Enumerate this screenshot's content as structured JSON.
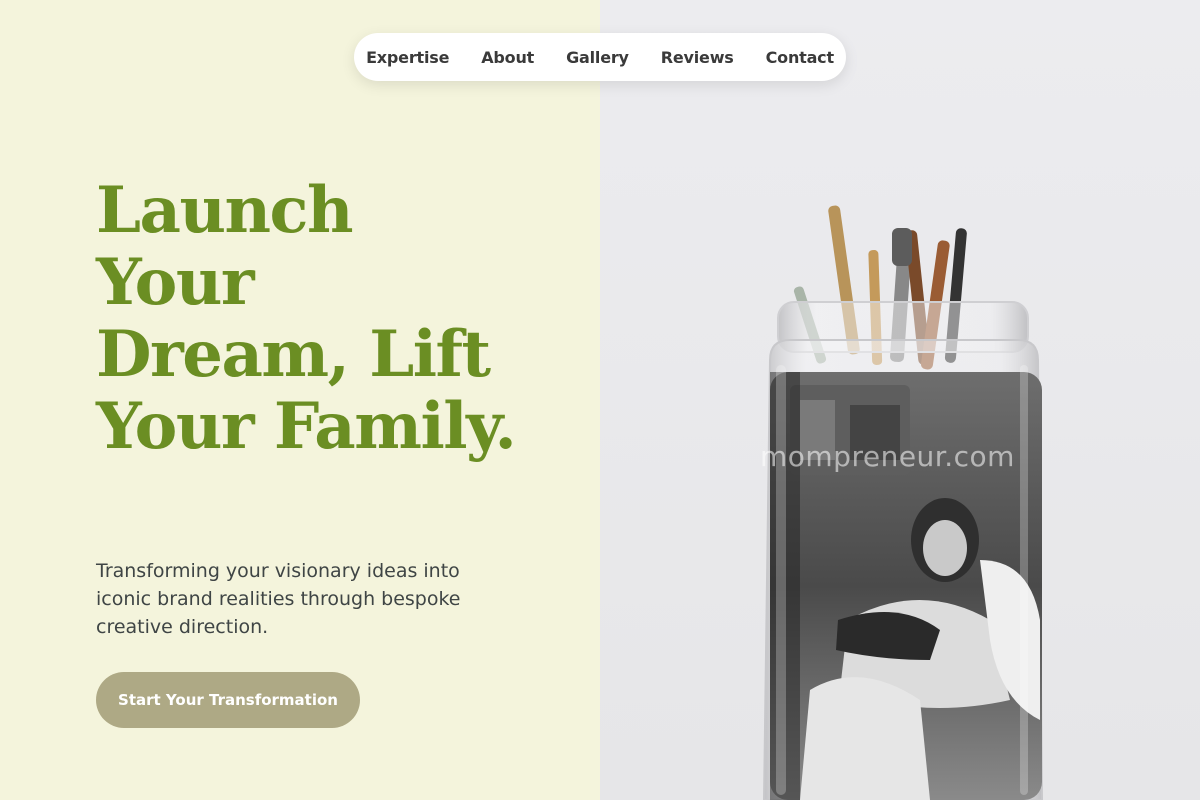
{
  "nav": {
    "items": [
      {
        "label": "Expertise"
      },
      {
        "label": "About"
      },
      {
        "label": "Gallery"
      },
      {
        "label": "Reviews"
      },
      {
        "label": "Contact"
      }
    ]
  },
  "hero": {
    "headline": "Launch Your Dream, Lift Your Family.",
    "subtext": "Transforming your visionary ideas into iconic brand realities through bespoke creative direction.",
    "cta_label": "Start Your Transformation"
  },
  "image": {
    "watermark": "mompreneur.com",
    "subject": "glass-jar-with-brushes-and-photo"
  },
  "colors": {
    "left_background": "#f4f4dc",
    "headline": "#6b8e23",
    "cta_background": "#aea985",
    "right_background": "#ececef"
  }
}
